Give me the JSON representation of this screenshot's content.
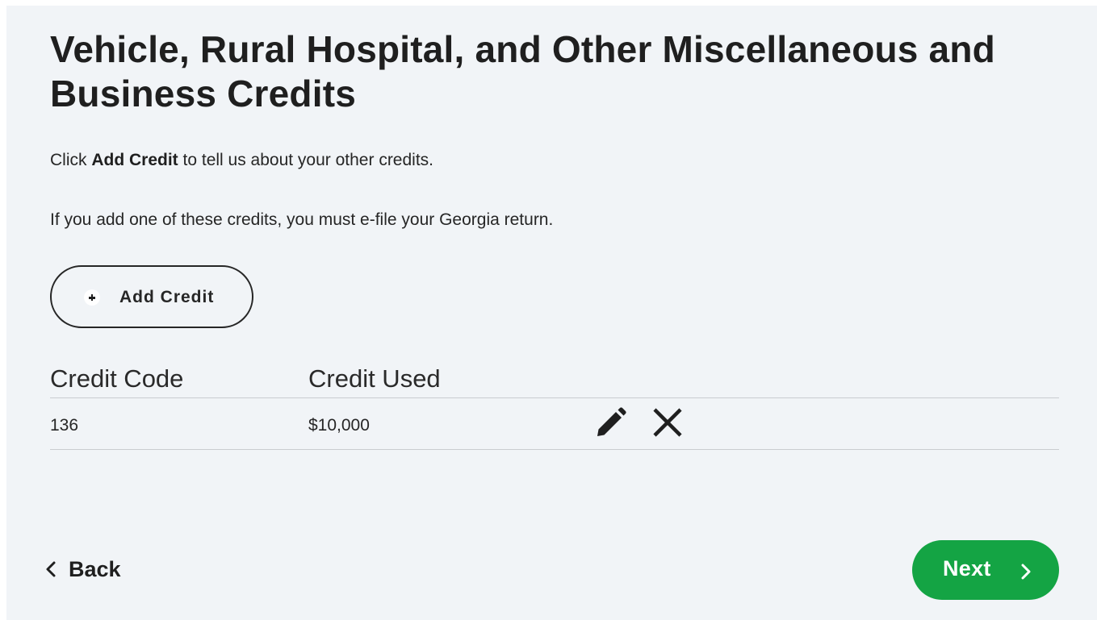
{
  "page": {
    "title": "Vehicle, Rural Hospital, and Other Miscellaneous and Business Credits",
    "instruction_prefix": "Click ",
    "instruction_bold": "Add Credit",
    "instruction_suffix": " to tell us about your other credits.",
    "note": "If you add one of these credits, you must e-file your Georgia return."
  },
  "add_button": {
    "label": "Add Credit",
    "icon": "plus-circle-icon"
  },
  "table": {
    "columns": [
      "Credit Code",
      "Credit Used"
    ],
    "rows": [
      {
        "credit_code": "136",
        "credit_used": "$10,000",
        "actions": [
          "pencil-icon",
          "close-icon"
        ]
      }
    ]
  },
  "nav": {
    "back_label": "Back",
    "next_label": "Next",
    "back_icon": "chevron-left-icon",
    "next_icon": "chevron-right-icon"
  },
  "colors": {
    "panel_background": "#f1f4f7",
    "primary_green": "#14a444",
    "text_dark": "#1f1f1f",
    "divider": "#c9ccd0"
  }
}
